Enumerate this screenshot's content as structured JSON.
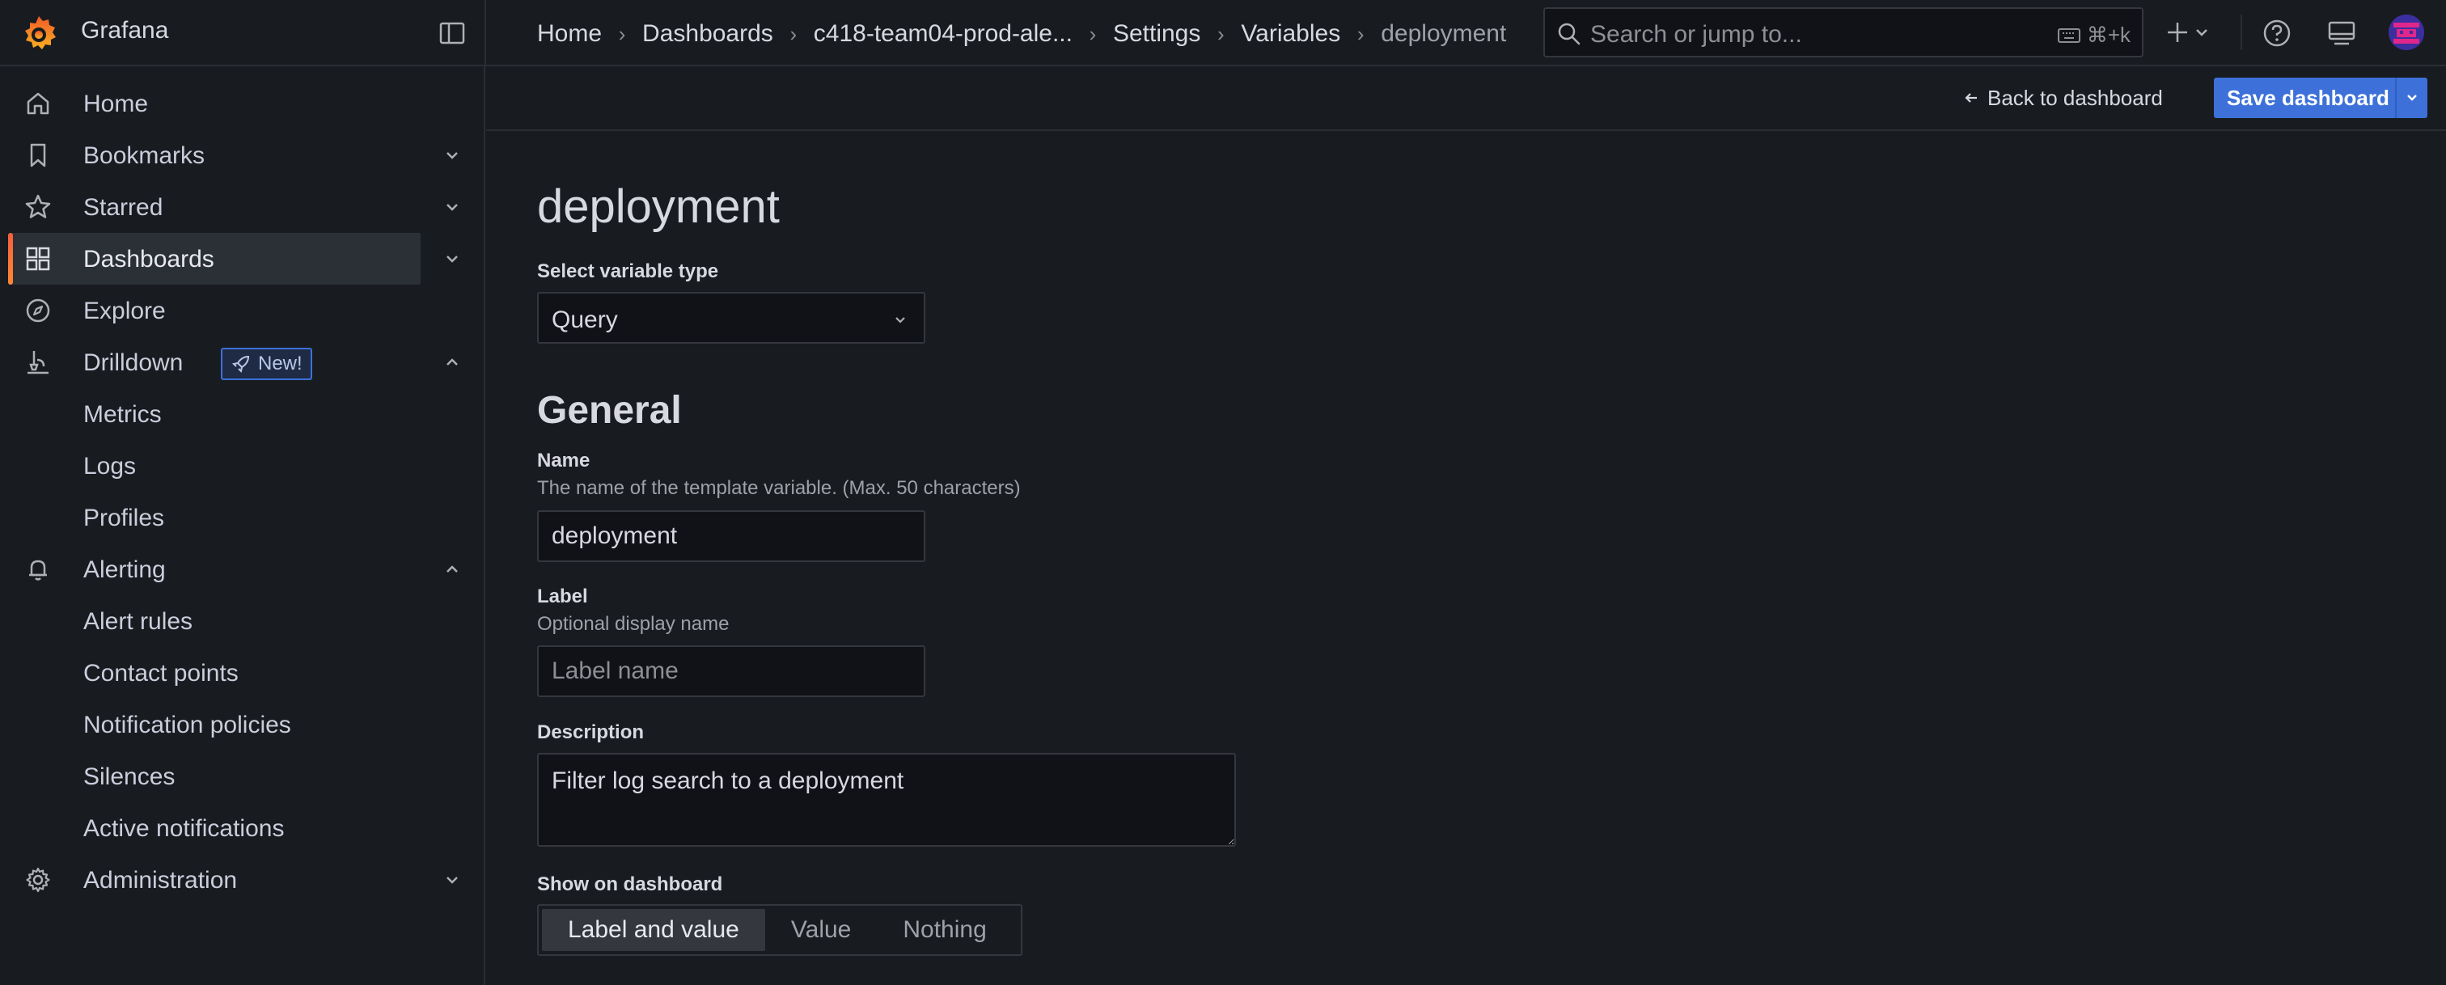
{
  "app": {
    "name": "Grafana"
  },
  "breadcrumb": [
    {
      "label": "Home"
    },
    {
      "label": "Dashboards"
    },
    {
      "label": "c418-team04-prod-ale..."
    },
    {
      "label": "Settings"
    },
    {
      "label": "Variables"
    },
    {
      "label": "deployment"
    }
  ],
  "search": {
    "placeholder": "Search or jump to...",
    "shortcut": "⌘+k"
  },
  "sidebar": {
    "items": [
      {
        "label": "Home",
        "icon": "home-icon"
      },
      {
        "label": "Bookmarks",
        "icon": "bookmark-icon",
        "chevron": "down"
      },
      {
        "label": "Starred",
        "icon": "star-icon",
        "chevron": "down"
      },
      {
        "label": "Dashboards",
        "icon": "dashboards-grid-icon",
        "chevron": "down",
        "active": true
      },
      {
        "label": "Explore",
        "icon": "compass-icon"
      },
      {
        "label": "Drilldown",
        "icon": "drilldown-icon",
        "chevron": "up",
        "badge": "New!"
      },
      {
        "label": "Metrics",
        "sub": true
      },
      {
        "label": "Logs",
        "sub": true
      },
      {
        "label": "Profiles",
        "sub": true
      },
      {
        "label": "Alerting",
        "icon": "bell-icon",
        "chevron": "up"
      },
      {
        "label": "Alert rules",
        "sub": true
      },
      {
        "label": "Contact points",
        "sub": true
      },
      {
        "label": "Notification policies",
        "sub": true
      },
      {
        "label": "Silences",
        "sub": true
      },
      {
        "label": "Active notifications",
        "sub": true
      },
      {
        "label": "Administration",
        "icon": "gear-icon",
        "chevron": "down"
      }
    ]
  },
  "toolbar": {
    "back_label": "Back to dashboard",
    "save_label": "Save dashboard"
  },
  "editor": {
    "title": "deployment",
    "type_label": "Select variable type",
    "type_value": "Query",
    "section_general": "General",
    "name_label": "Name",
    "name_desc": "The name of the template variable. (Max. 50 characters)",
    "name_value": "deployment",
    "label_label": "Label",
    "label_desc": "Optional display name",
    "label_placeholder": "Label name",
    "description_label": "Description",
    "description_value": "Filter log search to a deployment",
    "show_label": "Show on dashboard",
    "show_options": [
      "Label and value",
      "Value",
      "Nothing"
    ],
    "show_selected": "Label and value"
  },
  "colors": {
    "accent": "#3d71d9",
    "brand": "#f55f3e",
    "background": "#181b1f"
  }
}
